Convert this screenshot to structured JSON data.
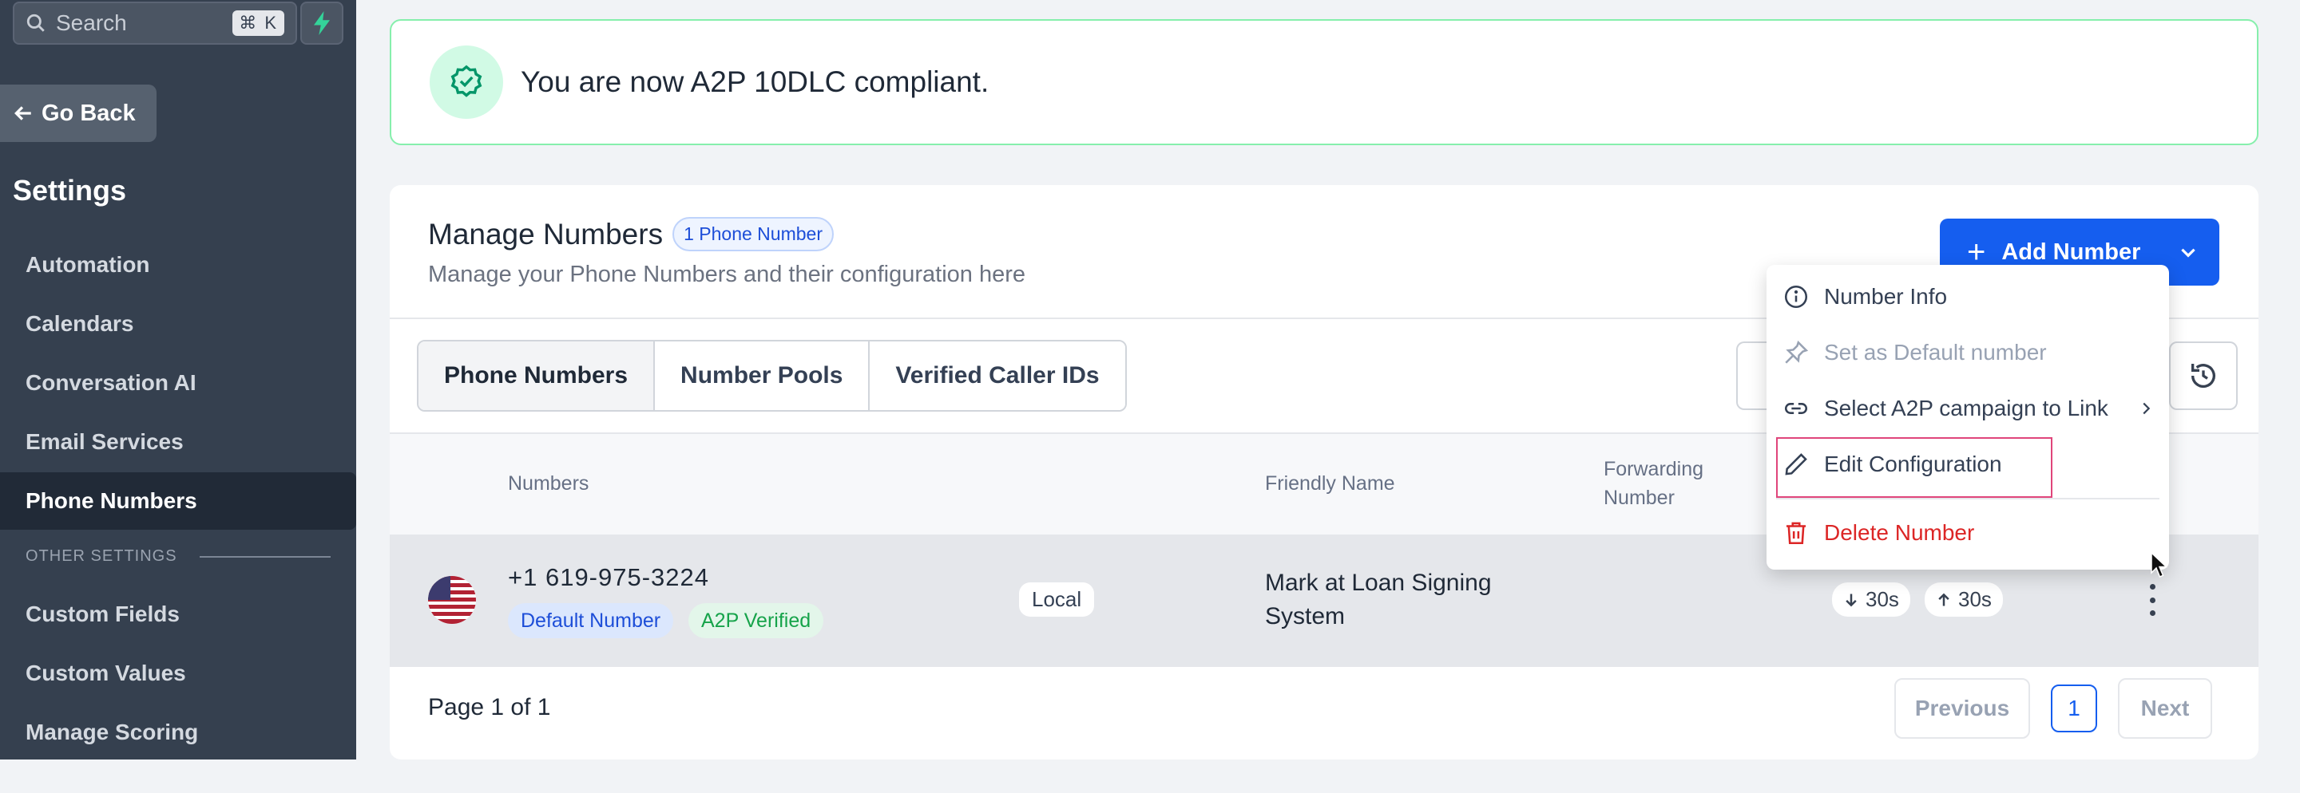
{
  "sidebar": {
    "search_placeholder": "Search",
    "search_shortcut": "⌘ K",
    "go_back": "Go Back",
    "settings_title": "Settings",
    "items": [
      {
        "label": "Automation"
      },
      {
        "label": "Calendars"
      },
      {
        "label": "Conversation AI"
      },
      {
        "label": "Email Services"
      },
      {
        "label": "Phone Numbers",
        "active": true
      }
    ],
    "other_settings_label": "OTHER SETTINGS",
    "other_items": [
      {
        "label": "Custom Fields"
      },
      {
        "label": "Custom Values"
      },
      {
        "label": "Manage Scoring"
      }
    ]
  },
  "banner": {
    "message": "You are now A2P 10DLC compliant."
  },
  "manage": {
    "title": "Manage Numbers",
    "count_badge": "1 Phone Number",
    "subtitle": "Manage your Phone Numbers and their configuration here",
    "add_button": "Add Number"
  },
  "tabs": [
    {
      "label": "Phone Numbers",
      "active": true
    },
    {
      "label": "Number Pools"
    },
    {
      "label": "Verified Caller IDs"
    }
  ],
  "table": {
    "headers": {
      "numbers": "Numbers",
      "friendly_name": "Friendly Name",
      "forwarding_line1": "Forwarding",
      "forwarding_line2": "Number"
    },
    "rows": [
      {
        "number": "+1 619-975-3224",
        "badges": [
          "Default Number",
          "A2P Verified"
        ],
        "type": "Local",
        "friendly_name_line1": "Mark at Loan Signing",
        "friendly_name_line2": "System",
        "inbound_timeout": "30s",
        "outbound_timeout": "30s"
      }
    ]
  },
  "pagination": {
    "info": "Page 1 of 1",
    "previous": "Previous",
    "current": "1",
    "next": "Next"
  },
  "menu": {
    "items": [
      {
        "label": "Number Info",
        "icon": "info-icon"
      },
      {
        "label": "Set as Default number",
        "icon": "pin-icon",
        "disabled": true
      },
      {
        "label": "Select A2P campaign to Link",
        "icon": "link-icon"
      },
      {
        "label": "Edit Configuration",
        "icon": "pencil-icon",
        "highlighted": true
      },
      {
        "label": "Delete Number",
        "icon": "trash-icon",
        "danger": true
      }
    ]
  },
  "colors": {
    "sidebar_bg": "#35404f",
    "primary": "#155eef",
    "success": "#16a34a",
    "danger": "#dc2626",
    "highlight_outline": "#e0457b"
  }
}
